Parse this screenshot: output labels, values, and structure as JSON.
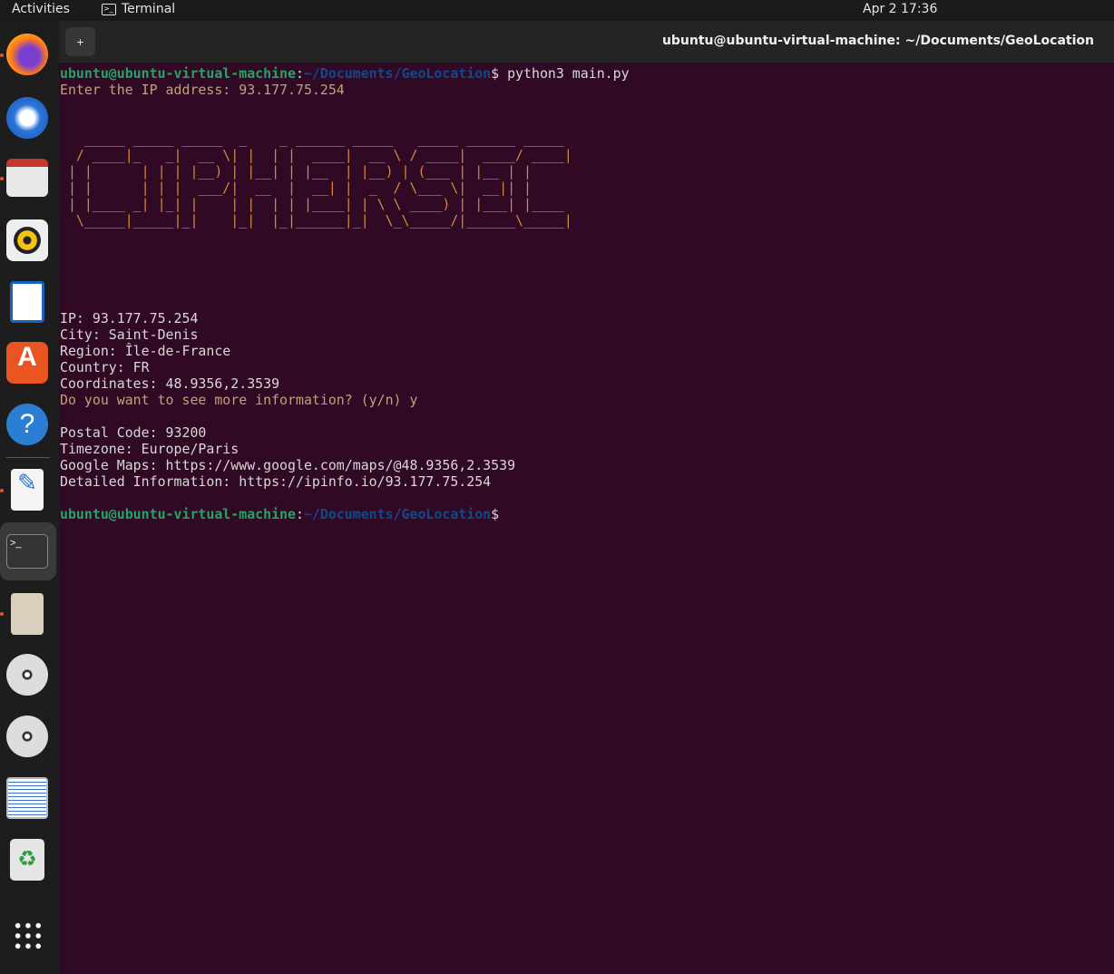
{
  "topbar": {
    "activities": "Activities",
    "app": "Terminal",
    "clock": "Apr 2  17:36"
  },
  "window": {
    "title": "ubuntu@ubuntu-virtual-machine: ~/Documents/GeoLocation",
    "new_tab": "+"
  },
  "dock": {
    "items": [
      "firefox",
      "thunderbird",
      "files",
      "rhythmbox",
      "libreoffice-writer",
      "app-center",
      "help",
      "text-editor",
      "terminal",
      "archive-manager",
      "dvd-drive",
      "dvd-drive",
      "document-viewer",
      "trash",
      "show-apps"
    ]
  },
  "terminal": {
    "prompt_user": "ubuntu@ubuntu-virtual-machine",
    "prompt_sep": ":",
    "prompt_path": "~/Documents/GeoLocation",
    "prompt_end": "$",
    "command": " python3 main.py",
    "input_prompt": "Enter the IP address: 93.177.75.254",
    "banner": "   _____ _____ _____  _    _ ______ _____   _____ ______ _____ \n  / ____|_   _|  __ \\| |  | |  ____|  __ \\ / ____|  ____/ ____|\n | |      | | | |__) | |__| | |__  | |__) | (___ | |__ | |     \n | |      | | |  ___/|  __  |  __| |  _  / \\___ \\|  __|| |     \n | |____ _| |_| |    | |  | | |____| | \\ \\ ____) | |___| |____ \n  \\_____|_____|_|    |_|  |_|______|_|  \\_\\_____/|______\\_____|",
    "info": [
      "IP: 93.177.75.254",
      "City: Saint-Denis",
      "Region: Île-de-France",
      "Country: FR",
      "Coordinates: 48.9356,2.3539"
    ],
    "more_prompt": "Do you want to see more information? (y/n) y",
    "more": [
      "Postal Code: 93200",
      "Timezone: Europe/Paris",
      "Google Maps: https://www.google.com/maps/@48.9356,2.3539",
      "Detailed Information: https://ipinfo.io/93.177.75.254"
    ]
  },
  "colors": {
    "background": "#300a24",
    "user": "#26a269",
    "path": "#12488b",
    "banner": "#d48a3c"
  }
}
